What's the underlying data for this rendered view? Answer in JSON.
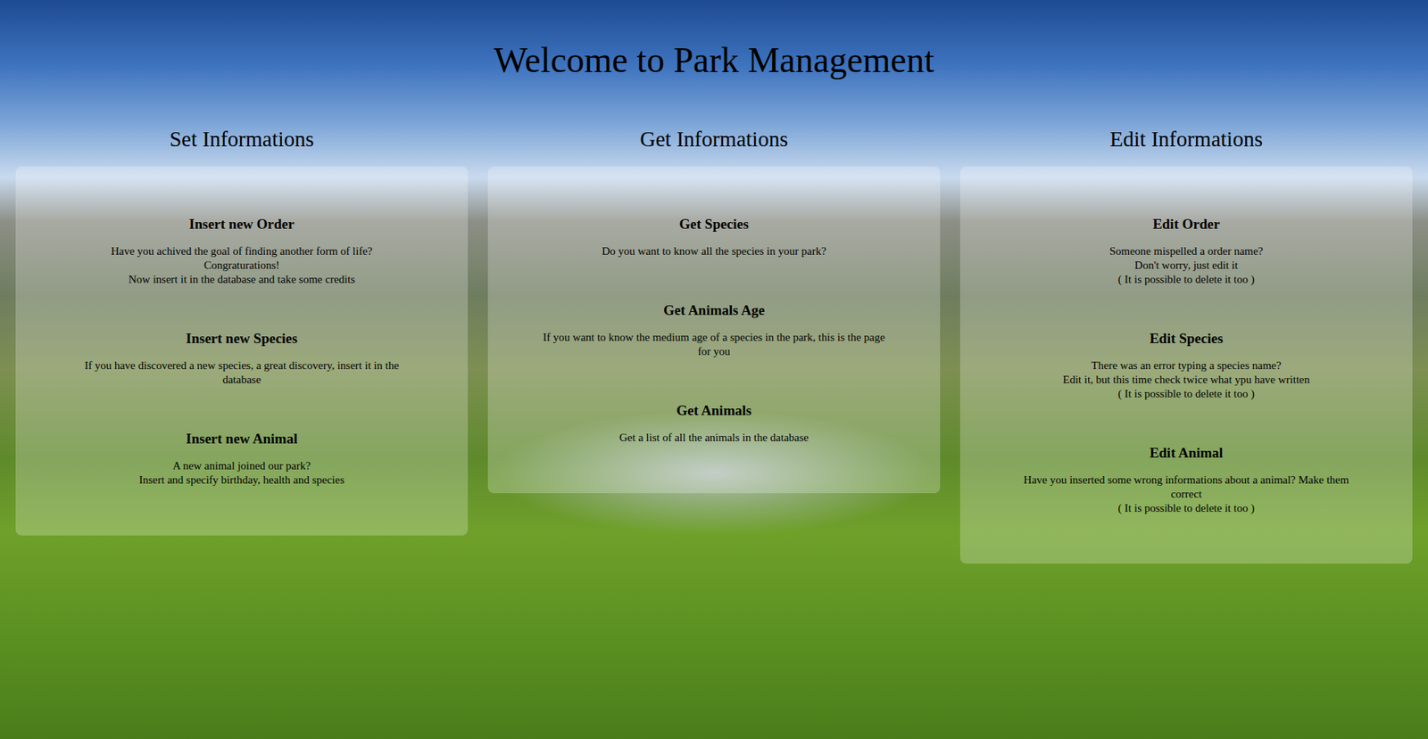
{
  "title": "Welcome to Park Management",
  "columns": [
    {
      "heading": "Set Informations",
      "items": [
        {
          "title": "Insert new Order",
          "lines": [
            "Have you achived the goal of finding another form of life?",
            "Congraturations!",
            "Now insert it in the database and take some credits"
          ]
        },
        {
          "title": "Insert new Species",
          "lines": [
            "If you have discovered a new species, a great discovery, insert it in the database"
          ]
        },
        {
          "title": "Insert new Animal",
          "lines": [
            "A new animal joined our park?",
            "Insert and specify birthday, health and species"
          ]
        }
      ]
    },
    {
      "heading": "Get Informations",
      "items": [
        {
          "title": "Get Species",
          "lines": [
            "Do you want to know all the species in your park?"
          ]
        },
        {
          "title": "Get Animals Age",
          "lines": [
            "If you want to know the medium age of a species in the park, this is the page for you"
          ]
        },
        {
          "title": "Get Animals",
          "lines": [
            "Get a list of all the animals in the database"
          ]
        }
      ]
    },
    {
      "heading": "Edit Informations",
      "items": [
        {
          "title": "Edit Order",
          "lines": [
            "Someone mispelled a order name?",
            "Don't worry, just edit it",
            "( It is possible to delete it too )"
          ]
        },
        {
          "title": "Edit Species",
          "lines": [
            "There was an error typing a species name?",
            "Edit it, but this time check twice what ypu have written",
            "( It is possible to delete it too )"
          ]
        },
        {
          "title": "Edit Animal",
          "lines": [
            "Have you inserted some wrong informations about a animal? Make them correct",
            "( It is possible to delete it too )"
          ]
        }
      ]
    }
  ]
}
